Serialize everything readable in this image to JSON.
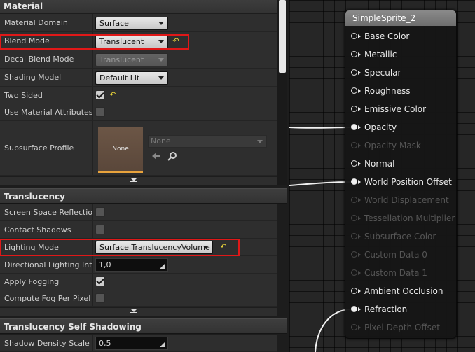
{
  "material": {
    "header": "Material",
    "material_domain": {
      "label": "Material Domain",
      "value": "Surface"
    },
    "blend_mode": {
      "label": "Blend Mode",
      "value": "Translucent"
    },
    "decal_blend_mode": {
      "label": "Decal Blend Mode",
      "value": "Translucent"
    },
    "shading_model": {
      "label": "Shading Model",
      "value": "Default Lit"
    },
    "two_sided": {
      "label": "Two Sided",
      "checked": true
    },
    "use_material_attributes": {
      "label": "Use Material Attributes",
      "checked": false
    },
    "subsurface_profile": {
      "label": "Subsurface Profile",
      "thumb_text": "None",
      "asset_value": "None"
    }
  },
  "translucency": {
    "header": "Translucency",
    "screen_space_reflections": {
      "label": "Screen Space Reflections",
      "checked": false
    },
    "contact_shadows": {
      "label": "Contact Shadows",
      "checked": false
    },
    "lighting_mode": {
      "label": "Lighting Mode",
      "value": "Surface TranslucencyVolume"
    },
    "directional_lighting_intensity": {
      "label": "Directional Lighting Intensity",
      "value": "1,0"
    },
    "apply_fogging": {
      "label": "Apply Fogging",
      "checked": true
    },
    "compute_fog_per_pixel": {
      "label": "Compute Fog Per Pixel",
      "checked": false
    }
  },
  "self_shadowing": {
    "header": "Translucency Self Shadowing",
    "shadow_density_scale": {
      "label": "Shadow Density Scale",
      "value": "0,5"
    }
  },
  "node": {
    "title": "SimpleSprite_2",
    "pins": [
      {
        "label": "Base Color",
        "active": true,
        "connected": false
      },
      {
        "label": "Metallic",
        "active": true,
        "connected": false
      },
      {
        "label": "Specular",
        "active": true,
        "connected": false
      },
      {
        "label": "Roughness",
        "active": true,
        "connected": false
      },
      {
        "label": "Emissive Color",
        "active": true,
        "connected": false
      },
      {
        "label": "Opacity",
        "active": true,
        "connected": true
      },
      {
        "label": "Opacity Mask",
        "active": false,
        "connected": false
      },
      {
        "label": "Normal",
        "active": true,
        "connected": false
      },
      {
        "label": "World Position Offset",
        "active": true,
        "connected": true
      },
      {
        "label": "World Displacement",
        "active": false,
        "connected": false
      },
      {
        "label": "Tessellation Multiplier",
        "active": false,
        "connected": false
      },
      {
        "label": "Subsurface Color",
        "active": false,
        "connected": false
      },
      {
        "label": "Custom Data 0",
        "active": false,
        "connected": false
      },
      {
        "label": "Custom Data 1",
        "active": false,
        "connected": false
      },
      {
        "label": "Ambient Occlusion",
        "active": true,
        "connected": false
      },
      {
        "label": "Refraction",
        "active": true,
        "connected": true
      },
      {
        "label": "Pixel Depth Offset",
        "active": false,
        "connected": false
      }
    ]
  },
  "colors": {
    "highlight": "#e01818",
    "reset_arrow": "#e8d33a",
    "accent_orange": "#e8a33c"
  },
  "icons": {
    "reset": "reset-arrow-icon",
    "browse": "search-icon",
    "use_selected": "arrow-left-icon"
  }
}
